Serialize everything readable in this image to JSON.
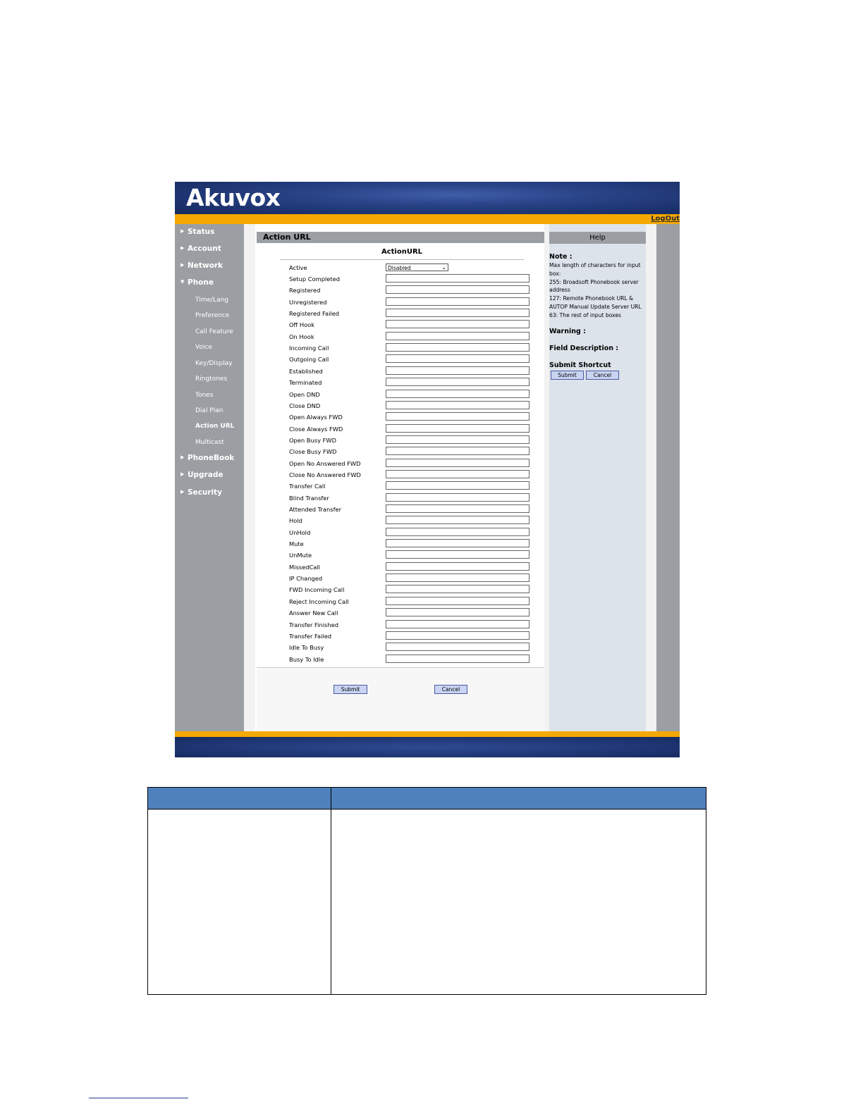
{
  "brand": {
    "logo_text": "Akuvox"
  },
  "header": {
    "logout_label": "LogOut"
  },
  "sidebar": {
    "items": [
      {
        "label": "Status",
        "arrow": "▶"
      },
      {
        "label": "Account",
        "arrow": "▶"
      },
      {
        "label": "Network",
        "arrow": "▶"
      },
      {
        "label": "Phone",
        "arrow": "▼"
      },
      {
        "label": "PhoneBook",
        "arrow": "▶"
      },
      {
        "label": "Upgrade",
        "arrow": "▶"
      },
      {
        "label": "Security",
        "arrow": "▶"
      }
    ],
    "phone_subitems": [
      "Time/Lang",
      "Preference",
      "Call Feature",
      "Voice",
      "Key/Display",
      "Ringtones",
      "Tones",
      "Dial Plan",
      "Action URL",
      "Multicast"
    ],
    "active_subitem": "Action URL"
  },
  "main": {
    "title": "Action URL",
    "form_heading": "ActionURL",
    "active": {
      "label": "Active",
      "value": "Disabled",
      "icon": "chevron-down-icon"
    },
    "fields": [
      {
        "label": "Setup Completed",
        "value": ""
      },
      {
        "label": "Registered",
        "value": ""
      },
      {
        "label": "Unregistered",
        "value": ""
      },
      {
        "label": "Registered Failed",
        "value": ""
      },
      {
        "label": "Off Hook",
        "value": ""
      },
      {
        "label": "On Hook",
        "value": ""
      },
      {
        "label": "Incoming Call",
        "value": ""
      },
      {
        "label": "Outgoing Call",
        "value": ""
      },
      {
        "label": "Established",
        "value": ""
      },
      {
        "label": "Terminated",
        "value": ""
      },
      {
        "label": "Open DND",
        "value": ""
      },
      {
        "label": "Close DND",
        "value": ""
      },
      {
        "label": "Open Always FWD",
        "value": ""
      },
      {
        "label": "Close Always FWD",
        "value": ""
      },
      {
        "label": "Open Busy FWD",
        "value": ""
      },
      {
        "label": "Close Busy FWD",
        "value": ""
      },
      {
        "label": "Open No Answered FWD",
        "value": ""
      },
      {
        "label": "Close No Answered FWD",
        "value": ""
      },
      {
        "label": "Transfer Call",
        "value": ""
      },
      {
        "label": "Blind Transfer",
        "value": ""
      },
      {
        "label": "Attended Transfer",
        "value": ""
      },
      {
        "label": "Hold",
        "value": ""
      },
      {
        "label": "UnHold",
        "value": ""
      },
      {
        "label": "Mute",
        "value": ""
      },
      {
        "label": "UnMute",
        "value": ""
      },
      {
        "label": "MissedCall",
        "value": ""
      },
      {
        "label": "IP Changed",
        "value": ""
      },
      {
        "label": "FWD Incoming Call",
        "value": ""
      },
      {
        "label": "Reject Incoming Call",
        "value": ""
      },
      {
        "label": "Answer New Call",
        "value": ""
      },
      {
        "label": "Transfer Finished",
        "value": ""
      },
      {
        "label": "Transfer Failed",
        "value": ""
      },
      {
        "label": "Idle To Busy",
        "value": ""
      },
      {
        "label": "Busy To Idle",
        "value": ""
      }
    ],
    "submit_label": "Submit",
    "cancel_label": "Cancel"
  },
  "help": {
    "title": "Help",
    "note_heading": "Note :",
    "note_lines": [
      "Max length of characters for input box:",
      "255: Broadsoft Phonebook server address",
      "127: Remote Phonebook URL & AUTOP Manual Update Server URL",
      "63: The rest of input boxes"
    ],
    "warning_heading": "Warning :",
    "field_desc_heading": "Field Description :",
    "shortcut_heading": "Submit Shortcut",
    "shortcut_submit": "Submit",
    "shortcut_cancel": "Cancel"
  },
  "colors": {
    "banner_blue": "#1d3470",
    "orange_bar": "#f5a800",
    "sidebar_gray": "#9b9ea3",
    "help_bg": "#dde3ea",
    "button_fill": "#c9d4f2",
    "table_header_blue": "#4f81bd"
  }
}
